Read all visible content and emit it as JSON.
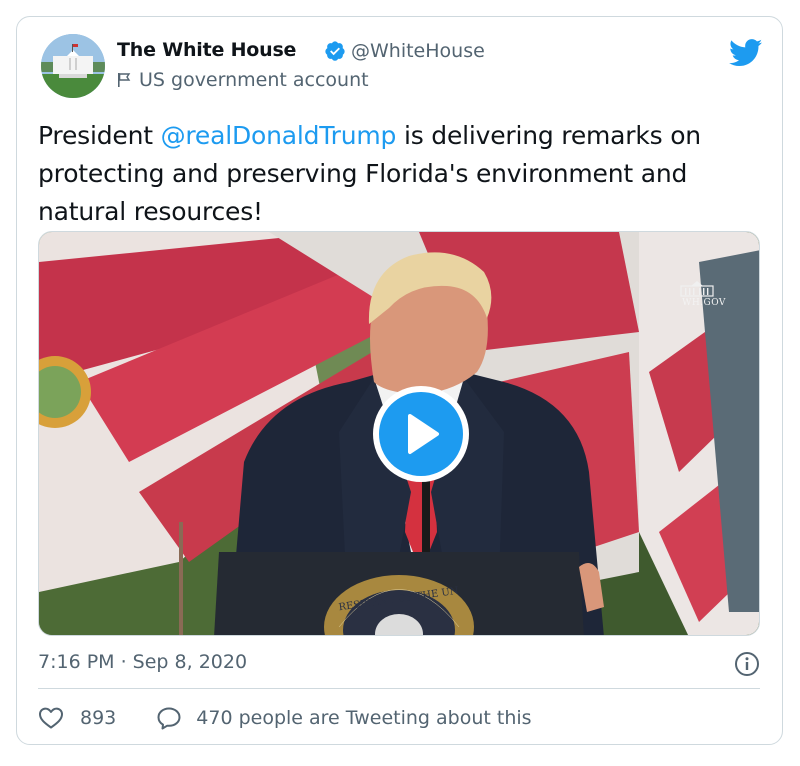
{
  "author": {
    "name": "The White House",
    "handle": "@WhiteHouse",
    "label": "US government account",
    "avatar_icon": "white-house-avatar",
    "verified_icon": "verified-badge-icon"
  },
  "tweet": {
    "text_before": "President ",
    "mention": "@realDonaldTrump",
    "text_after": " is delivering remarks on protecting and preserving Florida's environment and natural resources!"
  },
  "media": {
    "type": "video",
    "watermark": "WH.GOV",
    "seal_text": "RESIDENT OF THE UN",
    "play_icon": "play-icon"
  },
  "meta": {
    "timestamp": "7:16 PM · Sep 8, 2020"
  },
  "engagement": {
    "like_count": "893",
    "reply_text": "470 people are Tweeting about this"
  },
  "colors": {
    "accent": "#1d9bf0",
    "secondary_text": "#536471",
    "border": "#cfd9de"
  }
}
